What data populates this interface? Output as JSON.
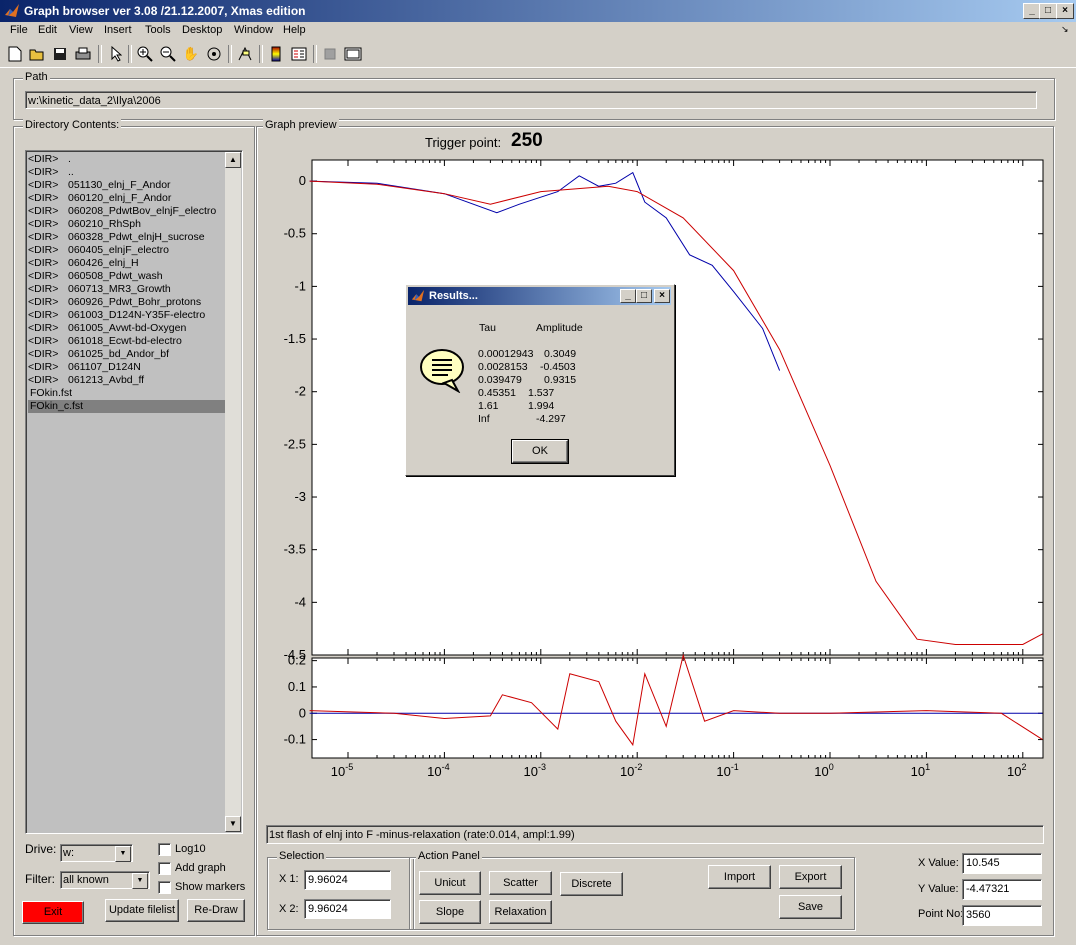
{
  "window": {
    "title": "Graph browser ver 3.08 /21.12.2007, Xmas edition",
    "controls": [
      "_",
      "□",
      "×"
    ]
  },
  "menu": [
    "File",
    "Edit",
    "View",
    "Insert",
    "Tools",
    "Desktop",
    "Window",
    "Help"
  ],
  "toolbar_icons": [
    "new-file-icon",
    "open-folder-icon",
    "save-icon",
    "print-icon",
    "pointer-icon",
    "zoom-in-icon",
    "zoom-out-icon",
    "pan-hand-icon",
    "rotate-icon",
    "data-cursor-icon",
    "colorbar-icon",
    "legend-icon",
    "hide-plot-tools-icon",
    "show-plot-tools-icon"
  ],
  "path": {
    "label": "Path",
    "value": "w:\\kinetic_data_2\\Ilya\\2006"
  },
  "directory": {
    "label": "Directory Contents:",
    "items": [
      {
        "tag": "<DIR>",
        "name": "."
      },
      {
        "tag": "<DIR>",
        "name": ".."
      },
      {
        "tag": "<DIR>",
        "name": "051130_elnj_F_Andor"
      },
      {
        "tag": "<DIR>",
        "name": "060120_elnj_F_Andor"
      },
      {
        "tag": "<DIR>",
        "name": "060208_PdwtBov_elnjF_electro"
      },
      {
        "tag": "<DIR>",
        "name": "060210_RhSph"
      },
      {
        "tag": "<DIR>",
        "name": "060328_Pdwt_elnjH_sucrose"
      },
      {
        "tag": "<DIR>",
        "name": "060405_elnjF_electro"
      },
      {
        "tag": "<DIR>",
        "name": "060426_elnj_H"
      },
      {
        "tag": "<DIR>",
        "name": "060508_Pdwt_wash"
      },
      {
        "tag": "<DIR>",
        "name": "060713_MR3_Growth"
      },
      {
        "tag": "<DIR>",
        "name": "060926_Pdwt_Bohr_protons"
      },
      {
        "tag": "<DIR>",
        "name": "061003_D124N-Y35F-electro"
      },
      {
        "tag": "<DIR>",
        "name": "061005_Avwt-bd-Oxygen"
      },
      {
        "tag": "<DIR>",
        "name": "061018_Ecwt-bd-electro"
      },
      {
        "tag": "<DIR>",
        "name": "061025_bd_Andor_bf"
      },
      {
        "tag": "<DIR>",
        "name": "061107_D124N"
      },
      {
        "tag": "<DIR>",
        "name": "061213_Avbd_ff"
      },
      {
        "tag": "",
        "name": "FOkin.fst"
      },
      {
        "tag": "",
        "name": "FOkin_c.fst",
        "selected": true
      }
    ]
  },
  "graph": {
    "label": "Graph preview",
    "trigger_label": "Trigger point:",
    "trigger_value": "250",
    "caption": "1st flash of elnj into F -minus-relaxation (rate:0.014, ampl:1.99)"
  },
  "chart_data": [
    {
      "type": "line",
      "name": "main-plot",
      "xscale": "log",
      "xlim": [
        4e-06,
        0.018
      ],
      "ylim": [
        -4.5,
        0.2
      ],
      "xticks": [
        "10-5",
        "10-4",
        "10-3",
        "10-2",
        "10-1",
        "100",
        "101",
        "102"
      ],
      "yticks": [
        "0",
        "-0.5",
        "-1",
        "-1.5",
        "-2",
        "-2.5",
        "-3",
        "-3.5",
        "-4",
        "-4.5"
      ],
      "series": [
        {
          "color": "#0000aa",
          "points": [
            [
              4e-06,
              0.0
            ],
            [
              2e-05,
              -0.02
            ],
            [
              0.0001,
              -0.12
            ],
            [
              0.00035,
              -0.3
            ],
            [
              0.0006,
              -0.22
            ],
            [
              0.0015,
              -0.1
            ],
            [
              0.0025,
              0.05
            ],
            [
              0.004,
              -0.05
            ],
            [
              0.006,
              -0.02
            ],
            [
              0.009,
              0.08
            ],
            [
              0.012,
              -0.2
            ],
            [
              0.02,
              -0.35
            ],
            [
              0.035,
              -0.7
            ],
            [
              0.06,
              -0.8
            ],
            [
              0.1,
              -1.05
            ],
            [
              0.2,
              -1.4
            ],
            [
              0.3,
              -1.8
            ]
          ]
        },
        {
          "color": "#cc0000",
          "points": [
            [
              4e-06,
              0.0
            ],
            [
              2e-05,
              -0.03
            ],
            [
              0.0001,
              -0.12
            ],
            [
              0.0003,
              -0.22
            ],
            [
              0.001,
              -0.1
            ],
            [
              0.005,
              -0.05
            ],
            [
              0.01,
              -0.1
            ],
            [
              0.03,
              -0.35
            ],
            [
              0.1,
              -0.85
            ],
            [
              0.3,
              -1.6
            ],
            [
              1,
              -2.7
            ],
            [
              3,
              -3.8
            ],
            [
              8,
              -4.35
            ],
            [
              20,
              -4.4
            ],
            [
              100,
              -4.4
            ],
            [
              160,
              -4.3
            ]
          ]
        }
      ]
    },
    {
      "type": "line",
      "name": "residual-plot",
      "xscale": "log",
      "ylim": [
        -0.15,
        0.2
      ],
      "xticks": [
        "10-5",
        "10-4",
        "10-3",
        "10-2",
        "10-1",
        "100",
        "101",
        "102"
      ],
      "yticks": [
        "0.2",
        "0.1",
        "0",
        "-0.1"
      ],
      "series": [
        {
          "color": "#0000aa",
          "points": [
            [
              4e-06,
              0
            ],
            [
              160,
              0
            ]
          ]
        },
        {
          "color": "#cc0000",
          "points": [
            [
              4e-06,
              0.01
            ],
            [
              3e-05,
              0.0
            ],
            [
              0.0001,
              -0.02
            ],
            [
              0.0003,
              -0.01
            ],
            [
              0.0004,
              0.07
            ],
            [
              0.0008,
              0.04
            ],
            [
              0.0015,
              -0.06
            ],
            [
              0.002,
              0.15
            ],
            [
              0.004,
              0.12
            ],
            [
              0.006,
              -0.03
            ],
            [
              0.009,
              -0.12
            ],
            [
              0.012,
              0.15
            ],
            [
              0.02,
              -0.05
            ],
            [
              0.03,
              0.22
            ],
            [
              0.05,
              -0.03
            ],
            [
              0.1,
              0.01
            ],
            [
              0.3,
              0.0
            ],
            [
              1,
              0.0
            ],
            [
              10,
              0.01
            ],
            [
              60,
              0.0
            ],
            [
              160,
              -0.1
            ]
          ]
        }
      ]
    }
  ],
  "dialog": {
    "title": "Results...",
    "headers": [
      "Tau",
      "Amplitude"
    ],
    "rows": [
      [
        "0.00012943",
        "0.3049"
      ],
      [
        "0.0028153",
        "-0.4503"
      ],
      [
        "0.039479",
        "0.9315"
      ],
      [
        "0.45351",
        "1.537"
      ],
      [
        "1.61",
        "1.994"
      ],
      [
        "Inf",
        "-4.297"
      ]
    ],
    "ok": "OK"
  },
  "controls": {
    "drive_label": "Drive:",
    "drive_value": "w:",
    "filter_label": "Filter:",
    "filter_value": "all known",
    "log10": "Log10",
    "add_graph": "Add graph",
    "show_markers": "Show markers",
    "exit": "Exit",
    "update": "Update filelist",
    "redraw": "Re-Draw"
  },
  "selection": {
    "label": "Selection",
    "x1_label": "X 1:",
    "x1_value": "9.96024",
    "x2_label": "X 2:",
    "x2_value": "9.96024"
  },
  "action": {
    "label": "Action Panel",
    "unicut": "Unicut",
    "scatter": "Scatter",
    "discrete": "Discrete",
    "slope": "Slope",
    "relaxation": "Relaxation",
    "import": "Import",
    "export": "Export",
    "save": "Save"
  },
  "values": {
    "x_label": "X Value:",
    "x_value": "10.545",
    "y_label": "Y Value:",
    "y_value": "-4.47321",
    "p_label": "Point No:",
    "p_value": "3560"
  },
  "colors": {
    "exit_button": "#ff0000",
    "title_gradient_start": "#0a246a",
    "title_gradient_end": "#a6caf0"
  }
}
